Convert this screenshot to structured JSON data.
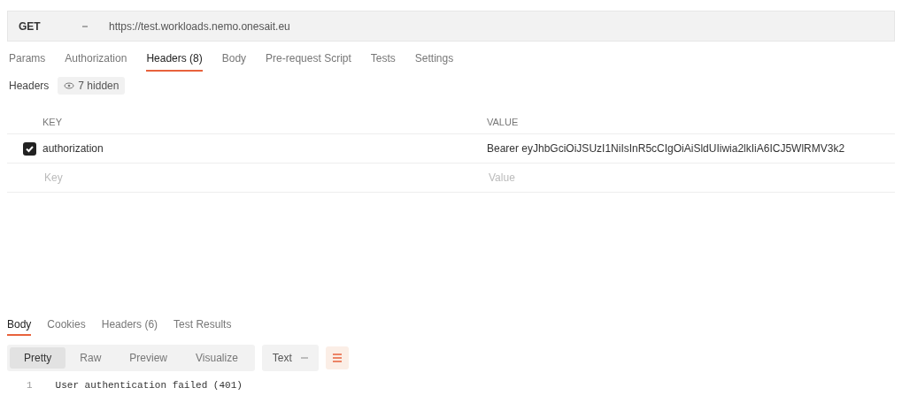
{
  "request": {
    "method": "GET",
    "url": "https://test.workloads.nemo.onesait.eu"
  },
  "request_tabs": [
    {
      "label": "Params",
      "selected": false
    },
    {
      "label": "Authorization",
      "selected": false
    },
    {
      "label": "Headers (8)",
      "selected": true
    },
    {
      "label": "Body",
      "selected": false
    },
    {
      "label": "Pre-request Script",
      "selected": false
    },
    {
      "label": "Tests",
      "selected": false
    },
    {
      "label": "Settings",
      "selected": false
    }
  ],
  "headers_bar": {
    "label": "Headers",
    "hidden_toggle": "7 hidden"
  },
  "headers_table": {
    "columns": [
      "KEY",
      "VALUE"
    ],
    "rows": [
      {
        "key": "authorization",
        "value": "Bearer eyJhbGciOiJSUzI1NiIsInR5cCIgOiAiSldUIiwia2lkIiA6ICJ5WlRMV3k2",
        "checked": true
      }
    ],
    "new_row": {
      "key_placeholder": "Key",
      "value_placeholder": "Value"
    }
  },
  "response_tabs": [
    {
      "label": "Body",
      "selected": true
    },
    {
      "label": "Cookies",
      "selected": false
    },
    {
      "label": "Headers (6)",
      "selected": false
    },
    {
      "label": "Test Results",
      "selected": false
    }
  ],
  "view_modes": [
    {
      "label": "Pretty",
      "selected": true
    },
    {
      "label": "Raw",
      "selected": false
    },
    {
      "label": "Preview",
      "selected": false
    },
    {
      "label": "Visualize",
      "selected": false
    }
  ],
  "format": "Text",
  "code_lines": [
    {
      "number": "1",
      "text": "User authentication failed (401)"
    }
  ]
}
